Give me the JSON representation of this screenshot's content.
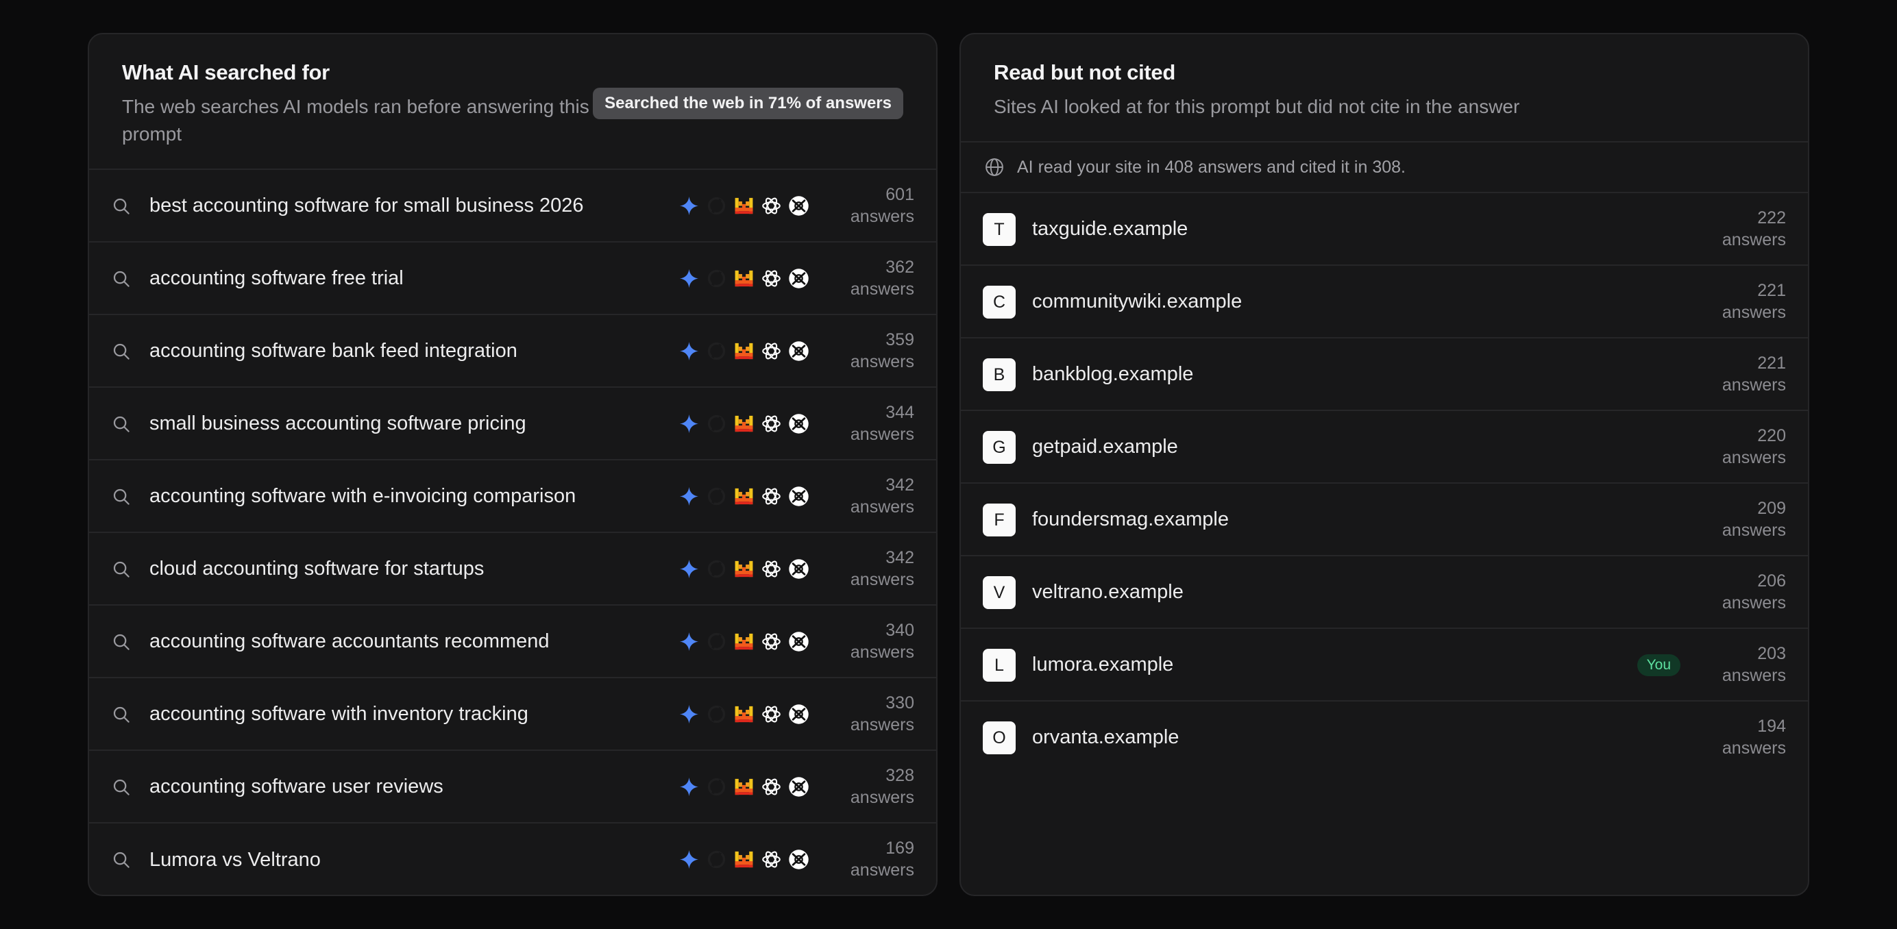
{
  "searches": {
    "title": "What AI searched for",
    "subtitle": "The web searches AI models ran before answering this prompt",
    "badge": "Searched the web in 71% of answers",
    "model_icons": [
      "gemini-icon",
      "perplexity-icon",
      "mistral-icon",
      "openai-icon",
      "grok-icon"
    ],
    "rows": [
      {
        "query": "best accounting software for small business 2026",
        "count": "601",
        "unit": "answers"
      },
      {
        "query": "accounting software free trial",
        "count": "362",
        "unit": "answers"
      },
      {
        "query": "accounting software bank feed integration",
        "count": "359",
        "unit": "answers"
      },
      {
        "query": "small business accounting software pricing",
        "count": "344",
        "unit": "answers"
      },
      {
        "query": "accounting software with e-invoicing comparison",
        "count": "342",
        "unit": "answers"
      },
      {
        "query": "cloud accounting software for startups",
        "count": "342",
        "unit": "answers"
      },
      {
        "query": "accounting software accountants recommend",
        "count": "340",
        "unit": "answers"
      },
      {
        "query": "accounting software with inventory tracking",
        "count": "330",
        "unit": "answers"
      },
      {
        "query": "accounting software user reviews",
        "count": "328",
        "unit": "answers"
      },
      {
        "query": "Lumora vs Veltrano",
        "count": "169",
        "unit": "answers"
      }
    ]
  },
  "not_cited": {
    "title": "Read but not cited",
    "subtitle": "Sites AI looked at for this prompt but did not cite in the answer",
    "info": "AI read your site in 408 answers and cited it in 308.",
    "you_label": "You",
    "sites": [
      {
        "letter": "T",
        "domain": "taxguide.example",
        "count": "222",
        "unit": "answers",
        "you": false
      },
      {
        "letter": "C",
        "domain": "communitywiki.example",
        "count": "221",
        "unit": "answers",
        "you": false
      },
      {
        "letter": "B",
        "domain": "bankblog.example",
        "count": "221",
        "unit": "answers",
        "you": false
      },
      {
        "letter": "G",
        "domain": "getpaid.example",
        "count": "220",
        "unit": "answers",
        "you": false
      },
      {
        "letter": "F",
        "domain": "foundersmag.example",
        "count": "209",
        "unit": "answers",
        "you": false
      },
      {
        "letter": "V",
        "domain": "veltrano.example",
        "count": "206",
        "unit": "answers",
        "you": false
      },
      {
        "letter": "L",
        "domain": "lumora.example",
        "count": "203",
        "unit": "answers",
        "you": true
      },
      {
        "letter": "O",
        "domain": "orvanta.example",
        "count": "194",
        "unit": "answers",
        "you": false
      }
    ]
  },
  "colors": {
    "background": "#0b0b0c",
    "panel": "#171718",
    "gemini_blue": "#4f86f7",
    "mistral_orange": "#f25a1c",
    "you_green": "#5ee0a0"
  }
}
